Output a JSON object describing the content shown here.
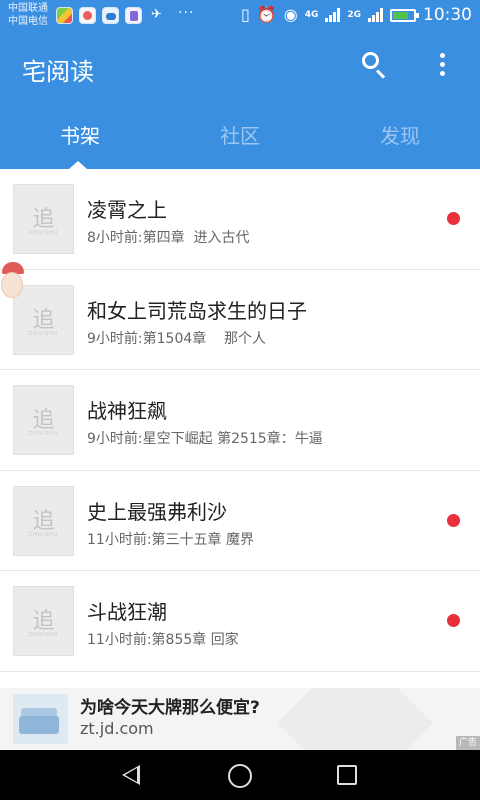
{
  "status_bar": {
    "carrier_1": "中国联通",
    "carrier_2": "中国电信",
    "more": "···",
    "network_4g": "4G",
    "network_2g": "2G",
    "time": "10:30",
    "battery_level": 0.7
  },
  "app_bar": {
    "title": "宅阅读",
    "tabs": [
      {
        "label": "书架",
        "active": true
      },
      {
        "label": "社区",
        "active": false
      },
      {
        "label": "发现",
        "active": false
      }
    ]
  },
  "books": [
    {
      "title": "凌霄之上",
      "meta": "8小时前:第四章  进入古代",
      "unread": true
    },
    {
      "title": "和女上司荒岛求生的日子",
      "meta": "9小时前:第1504章    那个人",
      "unread": false
    },
    {
      "title": "战神狂飙",
      "meta": "9小时前:星空下崛起 第2515章：牛逼",
      "unread": false
    },
    {
      "title": "史上最强弗利沙",
      "meta": "11小时前:第三十五章 魔界",
      "unread": true
    },
    {
      "title": "斗战狂潮",
      "meta": "11小时前:第855章 回家",
      "unread": true
    }
  ],
  "cover_placeholder": {
    "glyph": "追",
    "caption": "ZHUISHU"
  },
  "ad": {
    "title": "为啥今天大牌那么便宜?",
    "url": "zt.jd.com",
    "badge": "广告"
  },
  "colors": {
    "primary": "#3a8fe0",
    "unread_dot": "#e8303a"
  }
}
